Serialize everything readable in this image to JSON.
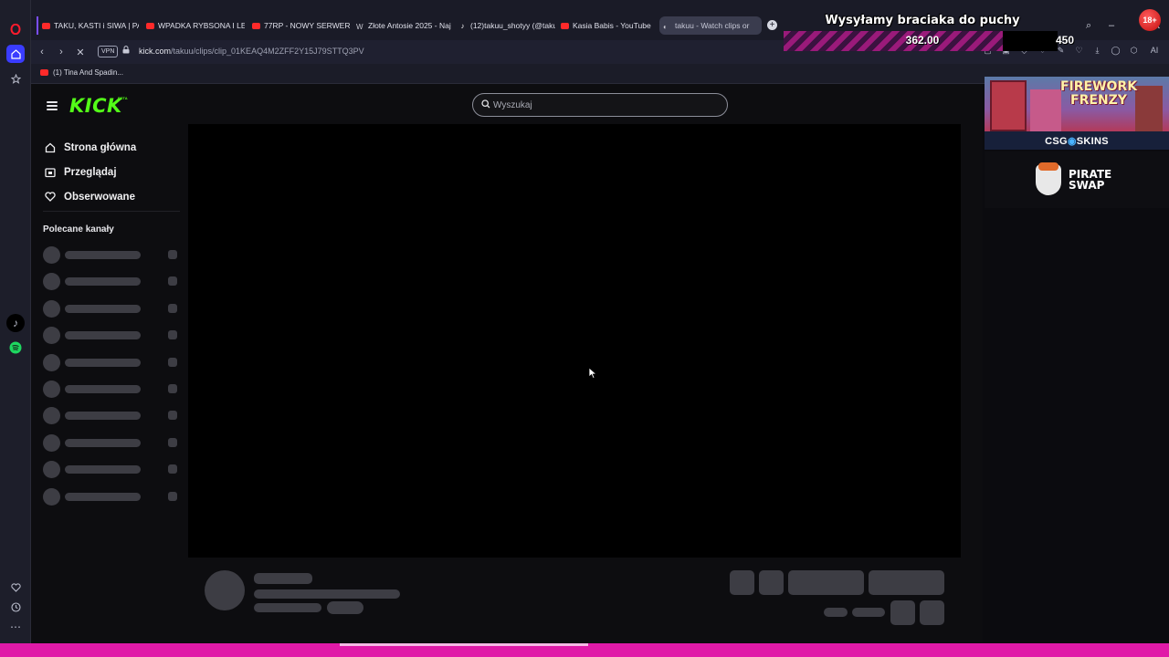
{
  "browser": {
    "tabs": [
      {
        "label": "TAKU, KASTI i SIWA | PATR",
        "icon": "youtube-icon"
      },
      {
        "label": "WPADKA RYBSONA I LEQ",
        "icon": "youtube-icon"
      },
      {
        "label": "77RP - NOWY SERWER W",
        "icon": "youtube-icon"
      },
      {
        "label": "Złote Antosie 2025 - Naj",
        "icon": "wiki-icon"
      },
      {
        "label": "(12)takuu_shotyy (@taku",
        "icon": "tiktok-icon"
      },
      {
        "label": "Kasia Babis - YouTube",
        "icon": "youtube-icon"
      },
      {
        "label": "takuu - Watch clips or",
        "icon": "speaker-icon"
      }
    ],
    "url_host": "kick.com",
    "url_path": "/takuu/clips/clip_01KEAQ4M2ZFF2Y15J79STTQ3PV",
    "vpn_label": "VPN",
    "bookmark": "(1) Tina And Spadin...",
    "ai_label": "AI"
  },
  "overlay": {
    "title": "Wysyłamy braciaka do puchy",
    "amount": "362.00",
    "goal": "450",
    "badge": "18+"
  },
  "kick": {
    "logo": "KICK",
    "beta": "BETA",
    "search_placeholder": "Wyszukaj",
    "nav": [
      {
        "label": "Strona główna",
        "icon": "home-icon"
      },
      {
        "label": "Przeglądaj",
        "icon": "browse-icon"
      },
      {
        "label": "Obserwowane",
        "icon": "heart-icon"
      }
    ],
    "recommended_title": "Polecane kanały"
  },
  "ads": {
    "ad1_headline": "FIREWORK FRENZY",
    "ad1_brand_a": "CSG",
    "ad1_brand_b": "SKINS",
    "ad2_brand_line1": "PIRATE",
    "ad2_brand_line2": "SWAP"
  },
  "colors": {
    "kick_green": "#53fc18",
    "stream_bar_pink": "#e01aa8"
  }
}
